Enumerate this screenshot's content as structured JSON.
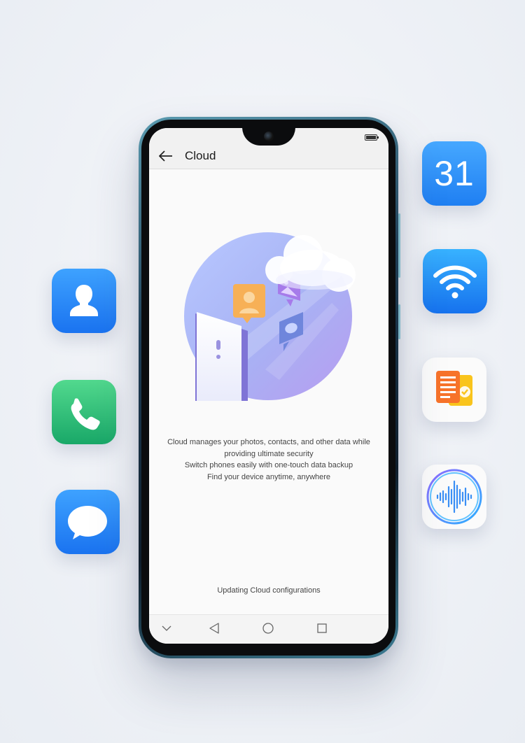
{
  "calendar_icon": {
    "day": "31",
    "color": "#2f8cf4"
  },
  "screen": {
    "title": "Cloud",
    "description_lines": [
      "Cloud manages your photos, contacts, and other data while",
      "providing ultimate security",
      "Switch phones easily with one-touch data backup",
      "Find your device anytime, anywhere"
    ],
    "status_text": "Updating Cloud configurations"
  },
  "icons": {
    "left": [
      "contacts-icon",
      "phone-icon",
      "messages-icon"
    ],
    "right": [
      "calendar-icon",
      "wifi-icon",
      "notes-icon",
      "recorder-icon"
    ],
    "nav": [
      "collapse-chevron-icon",
      "back-triangle-icon",
      "home-circle-icon",
      "recents-square-icon"
    ]
  },
  "colors": {
    "blue_icon": "#1f7ff2",
    "green_icon": "#2ec27a",
    "orange_icon": "#f7732a",
    "yellow_icon": "#f9c41c"
  }
}
